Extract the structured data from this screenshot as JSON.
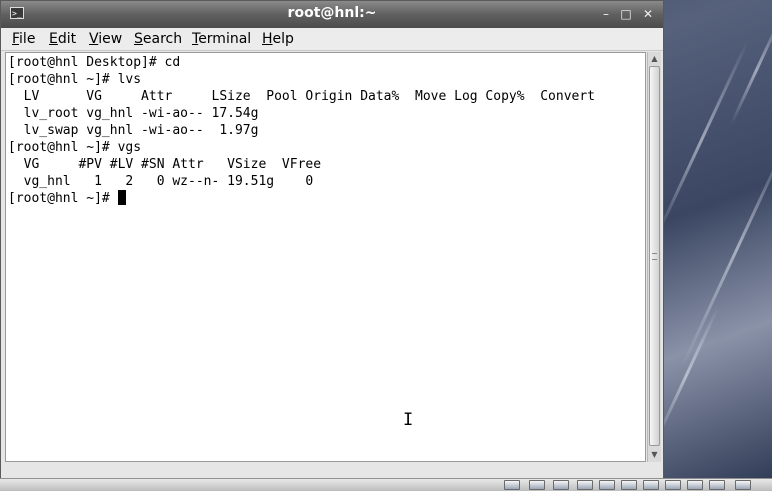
{
  "window": {
    "title": "root@hnl:~"
  },
  "titlebar_buttons": {
    "minimize": "–",
    "maximize": "□",
    "close": "✕"
  },
  "menu": {
    "items": [
      {
        "label_mnemonic": "F",
        "label_rest": "ile"
      },
      {
        "label_mnemonic": "E",
        "label_rest": "dit"
      },
      {
        "label_mnemonic": "V",
        "label_rest": "iew"
      },
      {
        "label_mnemonic": "S",
        "label_rest": "earch"
      },
      {
        "label_mnemonic": "T",
        "label_rest": "erminal"
      },
      {
        "label_mnemonic": "H",
        "label_rest": "elp"
      }
    ]
  },
  "terminal": {
    "lines": [
      "[root@hnl Desktop]# cd",
      "[root@hnl ~]# lvs",
      "  LV      VG     Attr     LSize  Pool Origin Data%  Move Log Copy%  Convert",
      "  lv_root vg_hnl -wi-ao-- 17.54g",
      "  lv_swap vg_hnl -wi-ao--  1.97g",
      "[root@hnl ~]# vgs",
      "  VG     #PV #LV #SN Attr   VSize  VFree",
      "  vg_hnl   1   2   0 wz--n- 19.51g    0"
    ],
    "prompt": "[root@hnl ~]# "
  },
  "scrollbar": {
    "up_arrow": "▲",
    "down_arrow": "▼"
  },
  "mouse_cursor": "I"
}
